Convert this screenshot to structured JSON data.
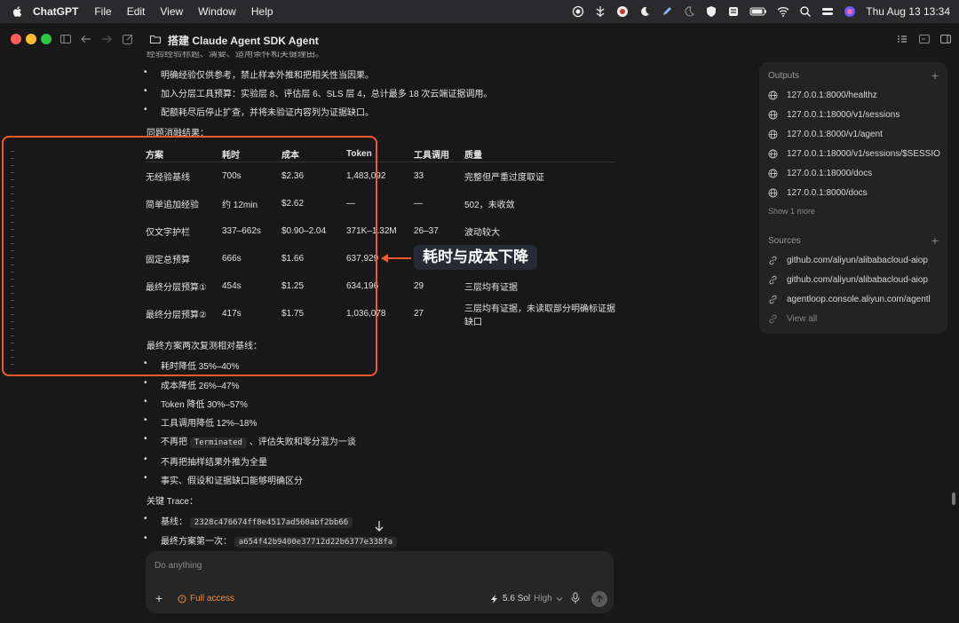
{
  "menubar": {
    "app": "ChatGPT",
    "menus": [
      "File",
      "Edit",
      "View",
      "Window",
      "Help"
    ],
    "clock": "Thu Aug 13  13:34"
  },
  "window": {
    "title": "搭建 Claude Agent SDK Agent",
    "more": "···"
  },
  "content": {
    "top_cut": "经验经验标题、清要、适用条件和关键理由。",
    "bullets_top": [
      "明确经验仅供参考，禁止样本外推和把相关性当因果。",
      "加入分层工具预算：实验层 8、评估层 6、SLS 层 4，总计最多 18 次云端证据调用。",
      "配额耗尽后停止扩查，并将未验证内容列为证据缺口。"
    ],
    "ablation_heading": "同题消融结果：",
    "table": {
      "headers": [
        "方案",
        "耗时",
        "成本",
        "Token",
        "工具调用",
        "质量"
      ],
      "rows": [
        [
          "无经验基线",
          "700s",
          "$2.36",
          "1,483,092",
          "33",
          "完整但严重过度取证"
        ],
        [
          "简单追加经验",
          "约 12min",
          "$2.62",
          "—",
          "—",
          "502，未收敛"
        ],
        [
          "仅文字护栏",
          "337–662s",
          "$0.90–2.04",
          "371K–1.32M",
          "26–37",
          "波动较大"
        ],
        [
          "固定总预算",
          "666s",
          "$1.66",
          "637,929",
          "",
          ""
        ],
        [
          "最终分层预算①",
          "454s",
          "$1.25",
          "634,196",
          "29",
          "三层均有证据"
        ],
        [
          "最终分层预算②",
          "417s",
          "$1.75",
          "1,036,078",
          "27",
          "三层均有证据，未读取部分明确标证据缺口"
        ]
      ]
    },
    "final_heading": "最终方案两次复测相对基线：",
    "final_bullets": [
      "耗时降低 35%–40%",
      "成本降低 26%–47%",
      "Token 降低 30%–57%",
      "工具调用降低 12%–18%"
    ],
    "terminated_pre": "不再把",
    "terminated_code": "Terminated",
    "terminated_post": "、评估失败和零分混为一谈",
    "more_bullets": [
      "不再把抽样结果外推为全量",
      "事实、假设和证据缺口能够明确区分"
    ],
    "trace_heading": "关键 Trace：",
    "traces": [
      {
        "label": "基线：",
        "id": "2328c476674ff8e4517ad560abf2bb66"
      },
      {
        "label": "最终方案第一次：",
        "id": "a654f42b9400e37712d22b6377e338fa"
      }
    ]
  },
  "annotation": {
    "label": "耗时与成本下降"
  },
  "panel": {
    "outputs_title": "Outputs",
    "outputs": [
      "127.0.0.1:8000/healthz",
      "127.0.0.1:18000/v1/sessions",
      "127.0.0.1:8000/v1/agent",
      "127.0.0.1:18000/v1/sessions/$SESSIO",
      "127.0.0.1:18000/docs",
      "127.0.0.1:8000/docs"
    ],
    "show_more": "Show 1 more",
    "sources_title": "Sources",
    "sources": [
      "github.com/aliyun/alibabacloud-aiop",
      "github.com/aliyun/alibabacloud-aiop",
      "agentloop.console.aliyun.com/agentl"
    ],
    "view_all": "View all"
  },
  "composer": {
    "placeholder": "Do anything",
    "access": "Full access",
    "model": "5.6 Sol",
    "effort": "High"
  },
  "colors": {
    "accent": "#ef5a2f",
    "access": "#f28c3b",
    "background": "#181818"
  }
}
